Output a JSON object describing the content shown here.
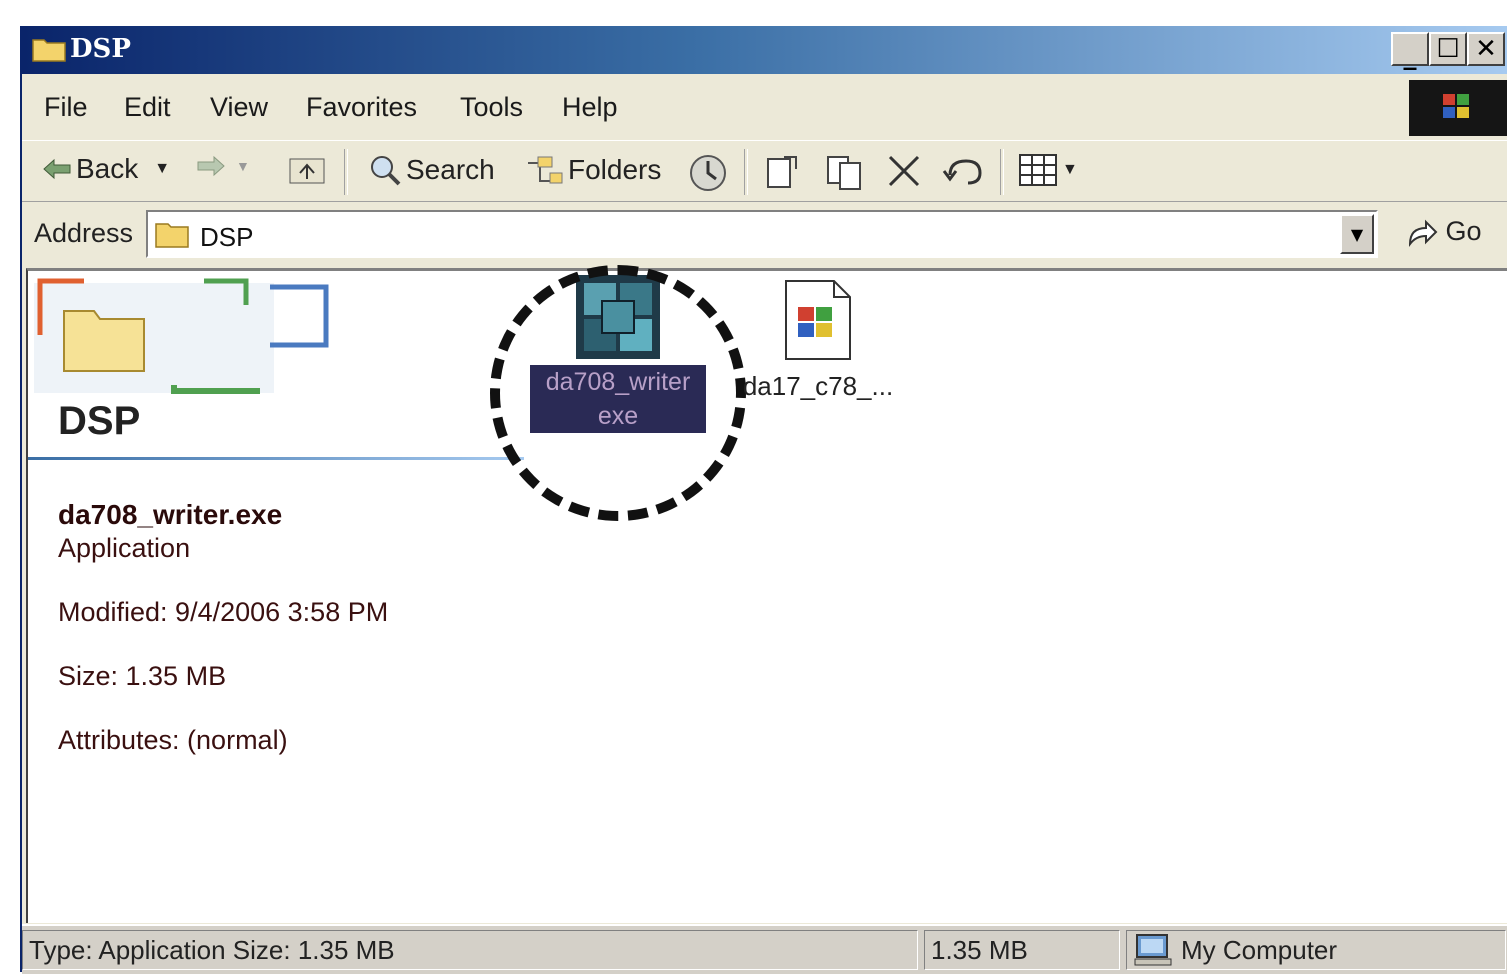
{
  "window": {
    "title": "DSP"
  },
  "menu": [
    "File",
    "Edit",
    "View",
    "Favorites",
    "Tools",
    "Help"
  ],
  "toolbar": {
    "back_label": "Back",
    "search_label": "Search",
    "folders_label": "Folders"
  },
  "address": {
    "label": "Address",
    "value": "DSP",
    "go_label": "Go"
  },
  "sidebar": {
    "folder_title": "DSP",
    "file_name": "da708_writer.exe",
    "file_type": "Application",
    "modified": "Modified: 9/4/2006 3:58 PM",
    "size": "Size: 1.35 MB",
    "attributes": "Attributes: (normal)"
  },
  "files": [
    {
      "label_line1": "da708_writer",
      "label_line2": "exe",
      "icon": "application-icon",
      "selected": true
    },
    {
      "label": "da17_c78_...",
      "icon": "installer-icon",
      "selected": false
    }
  ],
  "status": {
    "left": "Type: Application Size: 1.35 MB",
    "size": "1.35 MB",
    "zone": "My Computer"
  },
  "colors": {
    "title_dark": "#0a246a",
    "title_light": "#a6caf0",
    "selection": "#2a2a55"
  }
}
